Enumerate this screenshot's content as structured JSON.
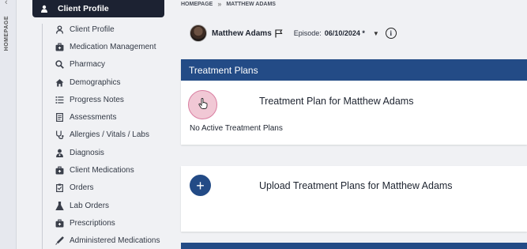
{
  "rail": {
    "label": "HOMEPAGE",
    "collapse_glyph": "‹"
  },
  "sidebar": {
    "active": {
      "label": "Client Profile",
      "icon": "person-icon"
    },
    "items": [
      {
        "label": "Client Profile",
        "icon": "person-icon"
      },
      {
        "label": "Medication Management",
        "icon": "medkit-icon"
      },
      {
        "label": "Pharmacy",
        "icon": "search-icon"
      },
      {
        "label": "Demographics",
        "icon": "home-icon"
      },
      {
        "label": "Progress Notes",
        "icon": "list-icon"
      },
      {
        "label": "Assessments",
        "icon": "document-icon"
      },
      {
        "label": "Allergies / Vitals / Labs",
        "icon": "stethoscope-icon"
      },
      {
        "label": "Diagnosis",
        "icon": "doctor-icon"
      },
      {
        "label": "Client Medications",
        "icon": "medkit-icon"
      },
      {
        "label": "Orders",
        "icon": "clipboard-icon"
      },
      {
        "label": "Lab Orders",
        "icon": "flask-icon"
      },
      {
        "label": "Prescriptions",
        "icon": "medkit-icon"
      },
      {
        "label": "Administered Medications",
        "icon": "syringe-icon"
      }
    ]
  },
  "breadcrumb": {
    "home": "HOMEPAGE",
    "separator": "»",
    "current": "MATTHEW ADAMS"
  },
  "patient": {
    "name": "Matthew Adams",
    "episode_label": "Episode:",
    "episode_value": "06/10/2024 *",
    "dropdown_glyph": "▼",
    "info_glyph": "i"
  },
  "treatment": {
    "header": "Treatment Plans",
    "plan_title": "Treatment Plan for Matthew Adams",
    "empty_text": "No Active Treatment Plans"
  },
  "upload": {
    "plus_glyph": "+",
    "title": "Upload Treatment Plans for Matthew Adams"
  },
  "colors": {
    "primary": "#234b86",
    "sidebar_active": "#1c2232",
    "highlight": "#f1c8d5"
  }
}
